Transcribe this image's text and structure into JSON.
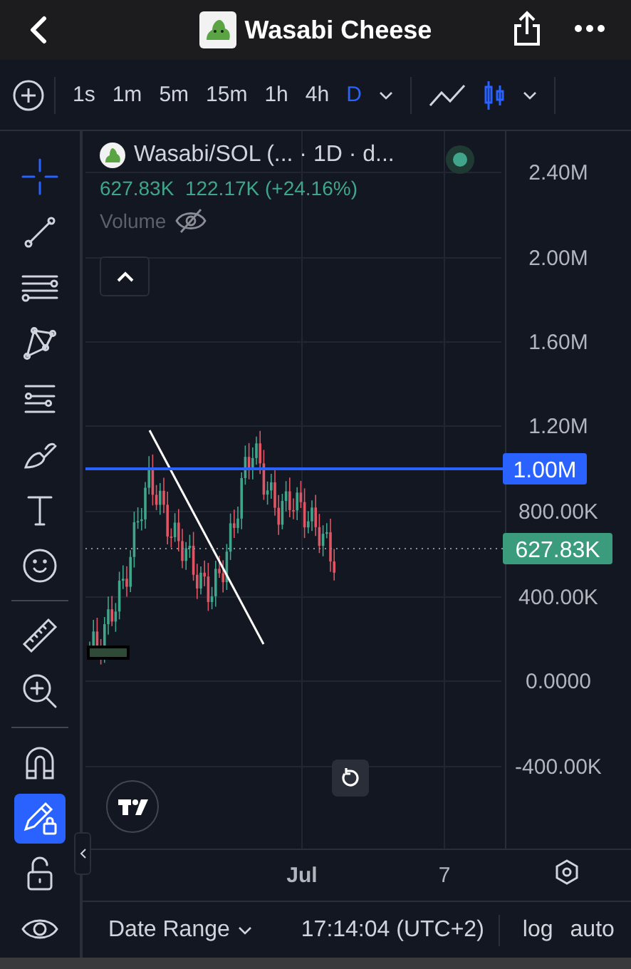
{
  "header": {
    "title": "Wasabi Cheese"
  },
  "toolbar": {
    "intervals": [
      {
        "label": "1s",
        "selected": false
      },
      {
        "label": "1m",
        "selected": false
      },
      {
        "label": "5m",
        "selected": false
      },
      {
        "label": "15m",
        "selected": false
      },
      {
        "label": "1h",
        "selected": false
      },
      {
        "label": "4h",
        "selected": false
      },
      {
        "label": "D",
        "selected": true
      }
    ],
    "chart_types": [
      {
        "kind": "line",
        "selected": false
      },
      {
        "kind": "candles",
        "selected": true
      }
    ]
  },
  "tools": [
    {
      "kind": "crosshair",
      "active": true
    },
    {
      "kind": "trend-line",
      "active": false
    },
    {
      "kind": "fib",
      "active": false
    },
    {
      "kind": "pattern",
      "active": false
    },
    {
      "kind": "projection",
      "active": false
    },
    {
      "kind": "brush",
      "active": false
    },
    {
      "kind": "text",
      "active": false
    },
    {
      "kind": "emoji",
      "active": false
    },
    {
      "kind": "divider"
    },
    {
      "kind": "ruler",
      "active": false
    },
    {
      "kind": "zoom",
      "active": false
    },
    {
      "kind": "divider"
    },
    {
      "kind": "magnet",
      "active": false
    },
    {
      "kind": "lock-drawing",
      "active": true
    },
    {
      "kind": "lock",
      "active": false
    },
    {
      "kind": "eye",
      "active": false
    }
  ],
  "legend": {
    "symbol": "Wasabi/SOL (... · 1D · d...",
    "price": "627.83K",
    "change": "122.17K (+24.16%)",
    "volume_label": "Volume",
    "volume_hidden": true
  },
  "price_axis": {
    "ticks": [
      "2.40M",
      "2.00M",
      "1.60M",
      "1.20M",
      "800.00K",
      "400.00K",
      "0.0000",
      "-400.00K"
    ],
    "markers": [
      {
        "kind": "horizontal-line",
        "label": "1.00M",
        "color": "#2962ff"
      },
      {
        "kind": "last-price",
        "label": "627.83K",
        "color": "#3a9b7d"
      }
    ]
  },
  "time_axis": {
    "labels": [
      "Jul",
      "7"
    ]
  },
  "bottom_bar": {
    "date_range": "Date Range",
    "time": "17:14:04 (UTC+2)",
    "buttons": [
      "log",
      "auto"
    ]
  }
}
